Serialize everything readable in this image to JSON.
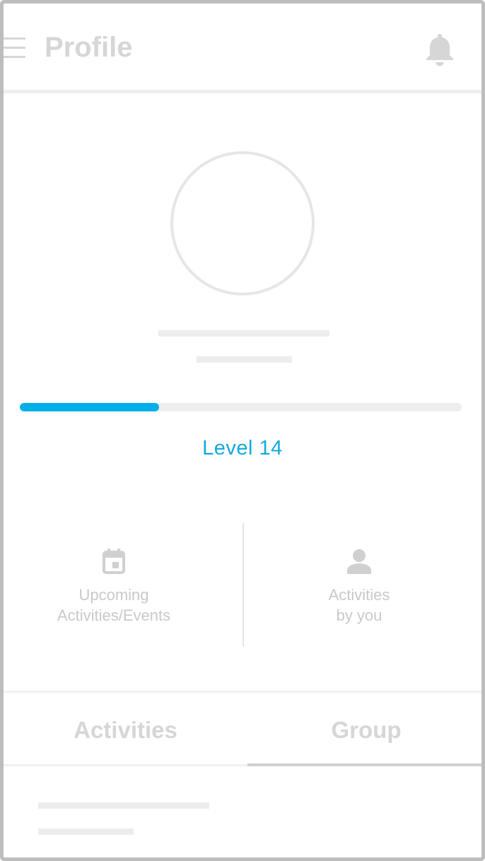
{
  "header": {
    "title": "Profile",
    "menu_icon": "hamburger-menu-icon",
    "notification_icon": "bell-icon"
  },
  "profile": {
    "level_label": "Level 14",
    "level_progress_fraction": 0.315
  },
  "stats": [
    {
      "icon": "calendar-icon",
      "label": "Upcoming\nActivities/Events"
    },
    {
      "icon": "person-icon",
      "label": "Activities\nby you"
    }
  ],
  "tabs": [
    {
      "label": "Activities",
      "selected": false
    },
    {
      "label": "Group",
      "selected": true
    }
  ],
  "colors": {
    "accent": "#00aee8",
    "level_text": "#12a8e0",
    "muted_text": "#c9c9c9",
    "placeholder": "#ededed",
    "frame_border": "#bdbdbd"
  }
}
